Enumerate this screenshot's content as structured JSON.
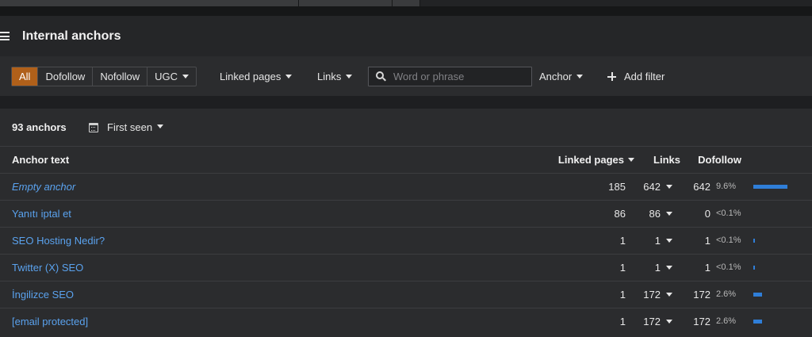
{
  "header": {
    "title": "Internal anchors"
  },
  "filters": {
    "type_options": [
      "All",
      "Dofollow",
      "Nofollow",
      "UGC"
    ],
    "active_type": "All",
    "linked_pages": "Linked pages",
    "links": "Links",
    "search_placeholder": "Word or phrase",
    "anchor": "Anchor",
    "add_filter": "Add filter"
  },
  "summary": {
    "count_label": "93 anchors",
    "sort_label": "First seen"
  },
  "table": {
    "columns": {
      "anchor_text": "Anchor text",
      "linked_pages": "Linked pages",
      "links": "Links",
      "dofollow": "Dofollow"
    },
    "rows": [
      {
        "anchor": "Empty anchor",
        "linked_pages": "185",
        "links": "642",
        "dofollow": "642",
        "pct": "9.6%",
        "pct_value": 9.6
      },
      {
        "anchor": "Yanıtı iptal et",
        "linked_pages": "86",
        "links": "86",
        "dofollow": "0",
        "pct": "<0.1%",
        "pct_value": 0
      },
      {
        "anchor": "SEO Hosting Nedir?",
        "linked_pages": "1",
        "links": "1",
        "dofollow": "1",
        "pct": "<0.1%",
        "pct_value": 0.05
      },
      {
        "anchor": "Twitter (X) SEO",
        "linked_pages": "1",
        "links": "1",
        "dofollow": "1",
        "pct": "<0.1%",
        "pct_value": 0.05
      },
      {
        "anchor": "İngilizce SEO",
        "linked_pages": "1",
        "links": "172",
        "dofollow": "172",
        "pct": "2.6%",
        "pct_value": 2.6
      },
      {
        "anchor": "[email protected]",
        "linked_pages": "1",
        "links": "172",
        "dofollow": "172",
        "pct": "2.6%",
        "pct_value": 2.6
      }
    ]
  },
  "colors": {
    "accent": "#b0601a",
    "link": "#5aa2ee",
    "bar": "#2f7ed8"
  }
}
